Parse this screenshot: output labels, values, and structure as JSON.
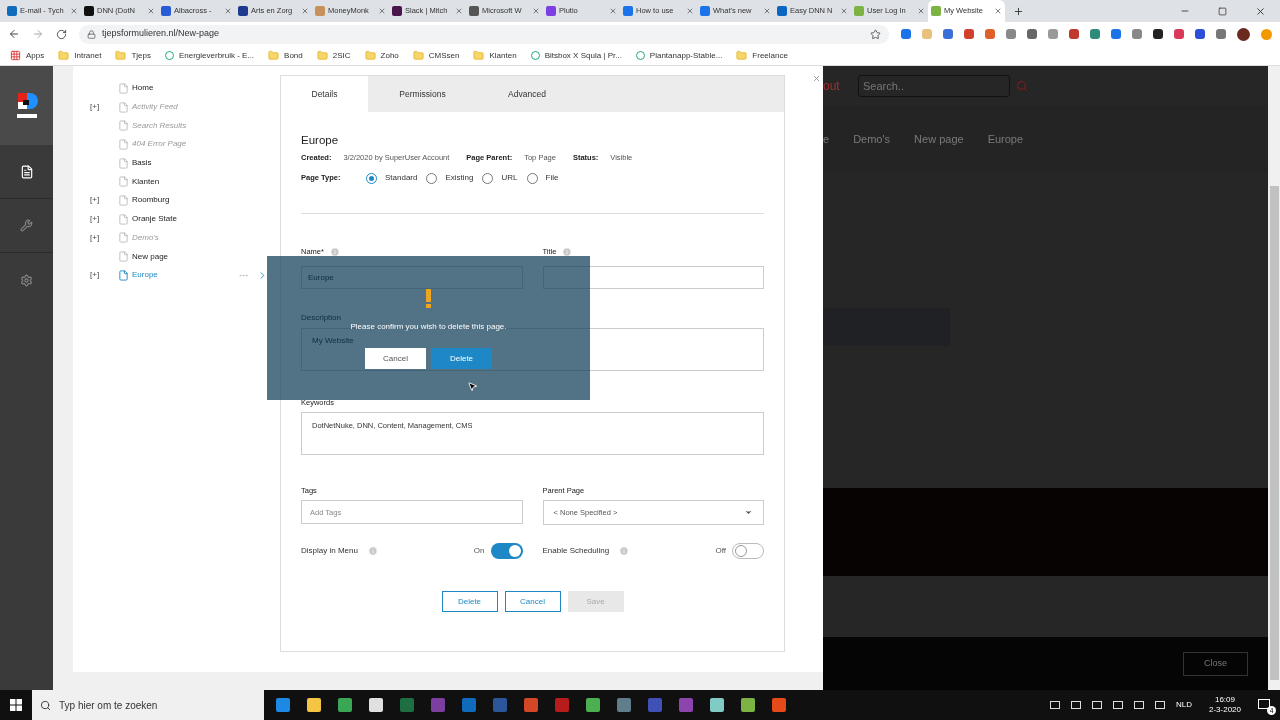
{
  "browser": {
    "tabs": [
      {
        "title": "E-mail - Tych",
        "color": "#0f6cbd",
        "selected": false
      },
      {
        "title": "DNN (DotN",
        "color": "#111111",
        "selected": false
      },
      {
        "title": "Albacross - ",
        "color": "#2a5bd7",
        "selected": false
      },
      {
        "title": "Arts en Zorg",
        "color": "#1f3b8f",
        "selected": false
      },
      {
        "title": "MoneyMonk",
        "color": "#c8915a",
        "selected": false
      },
      {
        "title": "Slack | Mitch",
        "color": "#4a154b",
        "selected": false
      },
      {
        "title": "Microsoft W",
        "color": "#555555",
        "selected": false
      },
      {
        "title": "Plutio",
        "color": "#7b3fe4",
        "selected": false
      },
      {
        "title": "How to use",
        "color": "#1a73e8",
        "selected": false
      },
      {
        "title": "What's new",
        "color": "#1a73e8",
        "selected": false
      },
      {
        "title": "Easy DNN N",
        "color": "#0a66c2",
        "selected": false
      },
      {
        "title": "User Log In",
        "color": "#7cb342",
        "selected": false
      },
      {
        "title": "My Website",
        "color": "#7cb342",
        "selected": true
      }
    ],
    "address": "tjepsformulieren.nl/New-page",
    "bookmarks": [
      {
        "label": "Apps",
        "kind": "apps"
      },
      {
        "label": "Intranet",
        "kind": "folder"
      },
      {
        "label": "Tjeps",
        "kind": "folder"
      },
      {
        "label": "Energieverbruik - E...",
        "kind": "site"
      },
      {
        "label": "Bond",
        "kind": "folder"
      },
      {
        "label": "2SIC",
        "kind": "folder"
      },
      {
        "label": "Zoho",
        "kind": "folder"
      },
      {
        "label": "CMSsen",
        "kind": "folder"
      },
      {
        "label": "Klanten",
        "kind": "folder"
      },
      {
        "label": "Bitsbox X Squla | Pr...",
        "kind": "site"
      },
      {
        "label": "Plantanapp-Stable...",
        "kind": "site"
      },
      {
        "label": "Freelance",
        "kind": "folder"
      }
    ]
  },
  "page_tree": [
    {
      "label": "Home",
      "hidden": false,
      "selected": false
    },
    {
      "label": "Activity Feed",
      "toggle": "[+]",
      "hidden": true,
      "selected": false
    },
    {
      "label": "Search Results",
      "hidden": true,
      "selected": false
    },
    {
      "label": "404 Error Page",
      "hidden": true,
      "selected": false
    },
    {
      "label": "Basis",
      "hidden": false,
      "selected": false
    },
    {
      "label": "Klanten",
      "hidden": false,
      "selected": false
    },
    {
      "label": "Roomburg",
      "toggle": "[+]",
      "hidden": false,
      "selected": false
    },
    {
      "label": "Oranje State",
      "toggle": "[+]",
      "hidden": false,
      "selected": false
    },
    {
      "label": "Demo's",
      "toggle": "[+]",
      "hidden": true,
      "selected": false
    },
    {
      "label": "New page",
      "hidden": false,
      "selected": false
    },
    {
      "label": "Europe",
      "toggle": "[+]",
      "hidden": false,
      "selected": true
    }
  ],
  "form": {
    "tabs": [
      {
        "label": "Details",
        "selected": true
      },
      {
        "label": "Permissions",
        "selected": false
      },
      {
        "label": "Advanced",
        "selected": false
      }
    ],
    "title": "Europe",
    "meta": [
      {
        "label": "Created:",
        "value": "3/2/2020 by SuperUser Account"
      },
      {
        "label": "Page Parent:",
        "value": "Top Page"
      },
      {
        "label": "Status:",
        "value": "Visible"
      }
    ],
    "page_type": {
      "label": "Page Type:",
      "options": [
        {
          "label": "Standard",
          "selected": true
        },
        {
          "label": "Existing",
          "selected": false
        },
        {
          "label": "URL",
          "selected": false
        },
        {
          "label": "File",
          "selected": false
        }
      ]
    },
    "name": {
      "label": "Name*",
      "value": "Europe"
    },
    "title_field": {
      "label": "Title"
    },
    "description": {
      "label": "Description",
      "value": "My Website"
    },
    "keywords": {
      "label": "Keywords",
      "value": "DotNetNuke, DNN, Content, Management, CMS"
    },
    "tags": {
      "label": "Tags",
      "placeholder": "Add Tags"
    },
    "parent_page": {
      "label": "Parent Page",
      "value": "< None Specified >"
    },
    "toggles": [
      {
        "label": "Display in Menu",
        "state_label": "On",
        "on": true
      },
      {
        "label": "Enable Scheduling",
        "state_label": "Off",
        "on": false
      }
    ],
    "buttons": [
      {
        "label": "Delete",
        "disabled": false
      },
      {
        "label": "Cancel",
        "disabled": false
      },
      {
        "label": "Save",
        "disabled": true
      }
    ]
  },
  "modal": {
    "message": "Please confirm you wish to delete this page.",
    "buttons": [
      {
        "label": "Cancel",
        "kind": "secondary"
      },
      {
        "label": "Delete",
        "kind": "primary"
      }
    ]
  },
  "site_behind": {
    "logout": "out",
    "search_placeholder": "Search..",
    "nav": [
      "e",
      "Demo's",
      "New page",
      "Europe"
    ],
    "close": "Close"
  },
  "taskbar": {
    "search_placeholder": "Typ hier om te zoeken",
    "language": "NLD",
    "time": "16:09",
    "date": "2-3-2020",
    "notifications": "4"
  }
}
